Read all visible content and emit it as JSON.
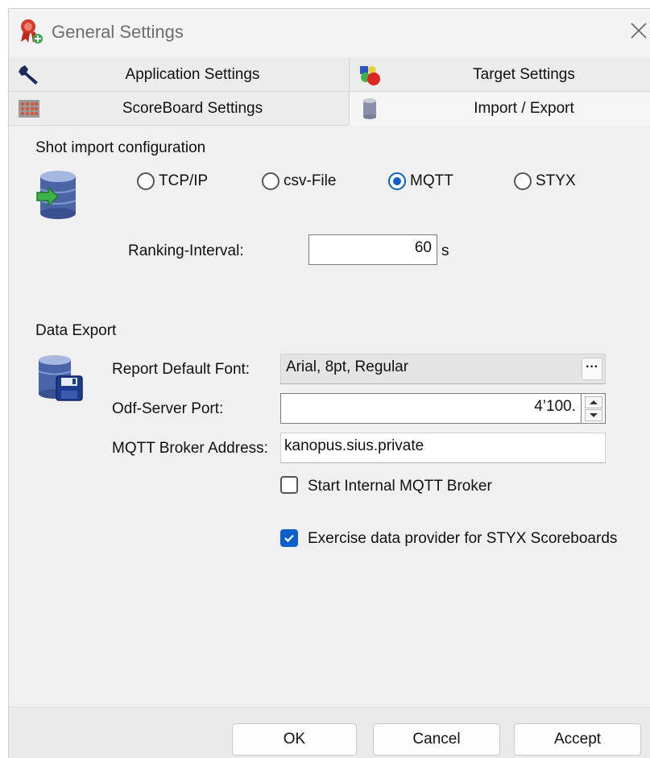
{
  "window": {
    "title": "General Settings"
  },
  "tabs": [
    {
      "label": "Application Settings",
      "icon": "wrench-icon"
    },
    {
      "label": "Target Settings",
      "icon": "target-colors-icon"
    },
    {
      "label": "ScoreBoard Settings",
      "icon": "scoreboard-icon"
    },
    {
      "label": "Import / Export",
      "icon": "database-icon",
      "active": true
    }
  ],
  "shot_import": {
    "heading": "Shot import configuration",
    "options": [
      {
        "label": "TCP/IP",
        "selected": false
      },
      {
        "label": "csv-File",
        "selected": false
      },
      {
        "label": "MQTT",
        "selected": true
      },
      {
        "label": "STYX",
        "selected": false
      }
    ],
    "ranking_interval": {
      "label": "Ranking-Interval:",
      "value": "60",
      "unit": "s"
    }
  },
  "data_export": {
    "heading": "Data Export",
    "report_font": {
      "label": "Report Default Font:",
      "value": "Arial, 8pt, Regular",
      "button": "···"
    },
    "odf_port": {
      "label": "Odf-Server Port:",
      "value": "4’100."
    },
    "mqtt_broker": {
      "label": "MQTT Broker Address:",
      "value": "kanopus.sius.private"
    },
    "start_internal_broker": {
      "label": "Start Internal MQTT Broker",
      "checked": false
    },
    "exercise_provider": {
      "label": "Exercise data provider for STYX Scoreboards",
      "checked": true
    }
  },
  "footer": {
    "ok": "OK",
    "cancel": "Cancel",
    "accept": "Accept"
  },
  "colors": {
    "accent": "#0b5fc8"
  }
}
